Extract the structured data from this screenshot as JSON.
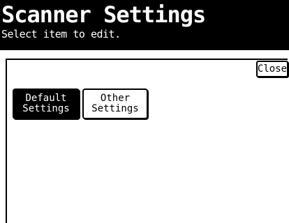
{
  "header": {
    "title": "Scanner Settings",
    "subtitle": "Select item to edit."
  },
  "buttons": {
    "close_label": "Close",
    "default_settings_label": "Default\nSettings",
    "other_settings_label": "Other\nSettings"
  },
  "colors": {
    "header_bg": "#000000",
    "header_text": "#ffffff",
    "selected_bg": "#000000",
    "selected_text": "#ffffff"
  }
}
